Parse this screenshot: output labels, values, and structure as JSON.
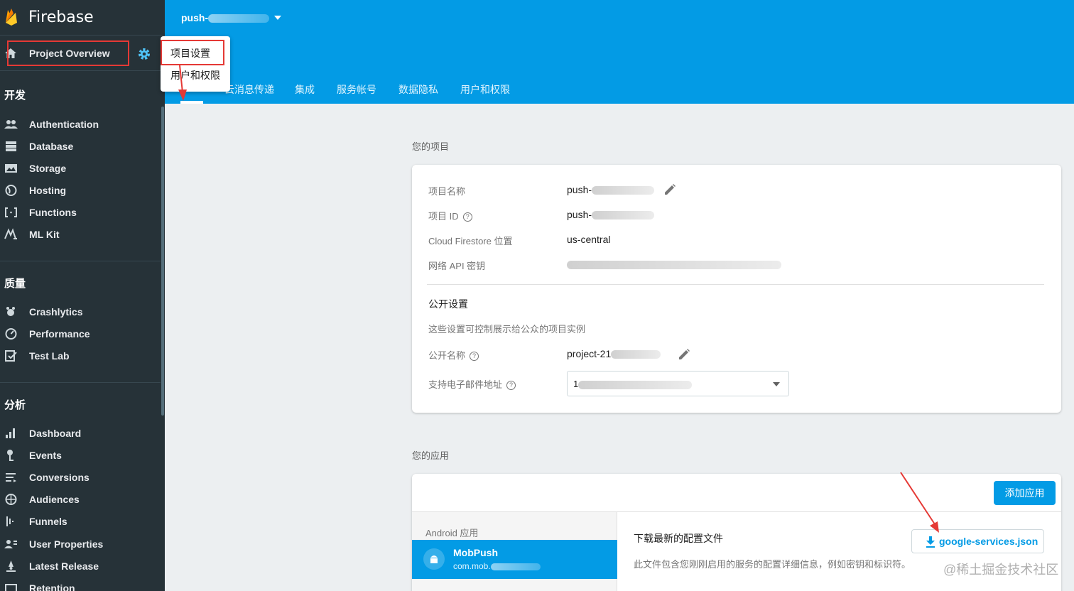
{
  "sidebar": {
    "brand": "Firebase",
    "overview_label": "Project Overview",
    "sections": [
      {
        "title": "开发",
        "items": [
          {
            "label": "Authentication",
            "icon": "people-icon"
          },
          {
            "label": "Database",
            "icon": "database-icon"
          },
          {
            "label": "Storage",
            "icon": "storage-icon"
          },
          {
            "label": "Hosting",
            "icon": "globe-icon"
          },
          {
            "label": "Functions",
            "icon": "functions-icon"
          },
          {
            "label": "ML Kit",
            "icon": "mlkit-icon"
          }
        ]
      },
      {
        "title": "质量",
        "items": [
          {
            "label": "Crashlytics",
            "icon": "crashlytics-icon"
          },
          {
            "label": "Performance",
            "icon": "performance-icon"
          },
          {
            "label": "Test Lab",
            "icon": "testlab-icon"
          }
        ]
      },
      {
        "title": "分析",
        "items": [
          {
            "label": "Dashboard",
            "icon": "bar-chart-icon"
          },
          {
            "label": "Events",
            "icon": "events-icon"
          },
          {
            "label": "Conversions",
            "icon": "conversions-icon"
          },
          {
            "label": "Audiences",
            "icon": "audiences-icon"
          },
          {
            "label": "Funnels",
            "icon": "funnels-icon"
          },
          {
            "label": "User Properties",
            "icon": "user-properties-icon"
          },
          {
            "label": "Latest Release",
            "icon": "latest-release-icon"
          },
          {
            "label": "Retention",
            "icon": "retention-icon"
          }
        ]
      }
    ]
  },
  "header": {
    "project_name": "push-",
    "tabs": [
      "云消息传递",
      "集成",
      "服务帐号",
      "数据隐私",
      "用户和权限"
    ]
  },
  "menu": {
    "items": [
      "项目设置",
      "用户和权限"
    ]
  },
  "project": {
    "section_label": "您的项目",
    "rows": [
      {
        "label": "项目名称",
        "value": "push-"
      },
      {
        "label": "项目 ID",
        "value": "push-"
      },
      {
        "label": "Cloud Firestore 位置",
        "value": "us-central"
      },
      {
        "label": "网络 API 密钥",
        "value": ""
      }
    ],
    "public_title": "公开设置",
    "public_desc": "这些设置可控制展示给公众的项目实例",
    "public_name_label": "公开名称",
    "public_name_value": "project-21",
    "support_email_label": "支持电子邮件地址",
    "support_email_value": "1"
  },
  "apps": {
    "section_label": "您的应用",
    "add_button": "添加应用",
    "platform_label": "Android 应用",
    "app_name": "MobPush",
    "app_package": "com.mob.",
    "download_title": "下载最新的配置文件",
    "download_desc": "此文件包含您刚刚启用的服务的配置详细信息，例如密钥和标识符。",
    "download_button": "google-services.json"
  },
  "watermark": "@稀土掘金技术社区",
  "colors": {
    "sidebar_bg": "#263238",
    "header_blue": "#039be5",
    "annotation_red": "#e53935"
  }
}
